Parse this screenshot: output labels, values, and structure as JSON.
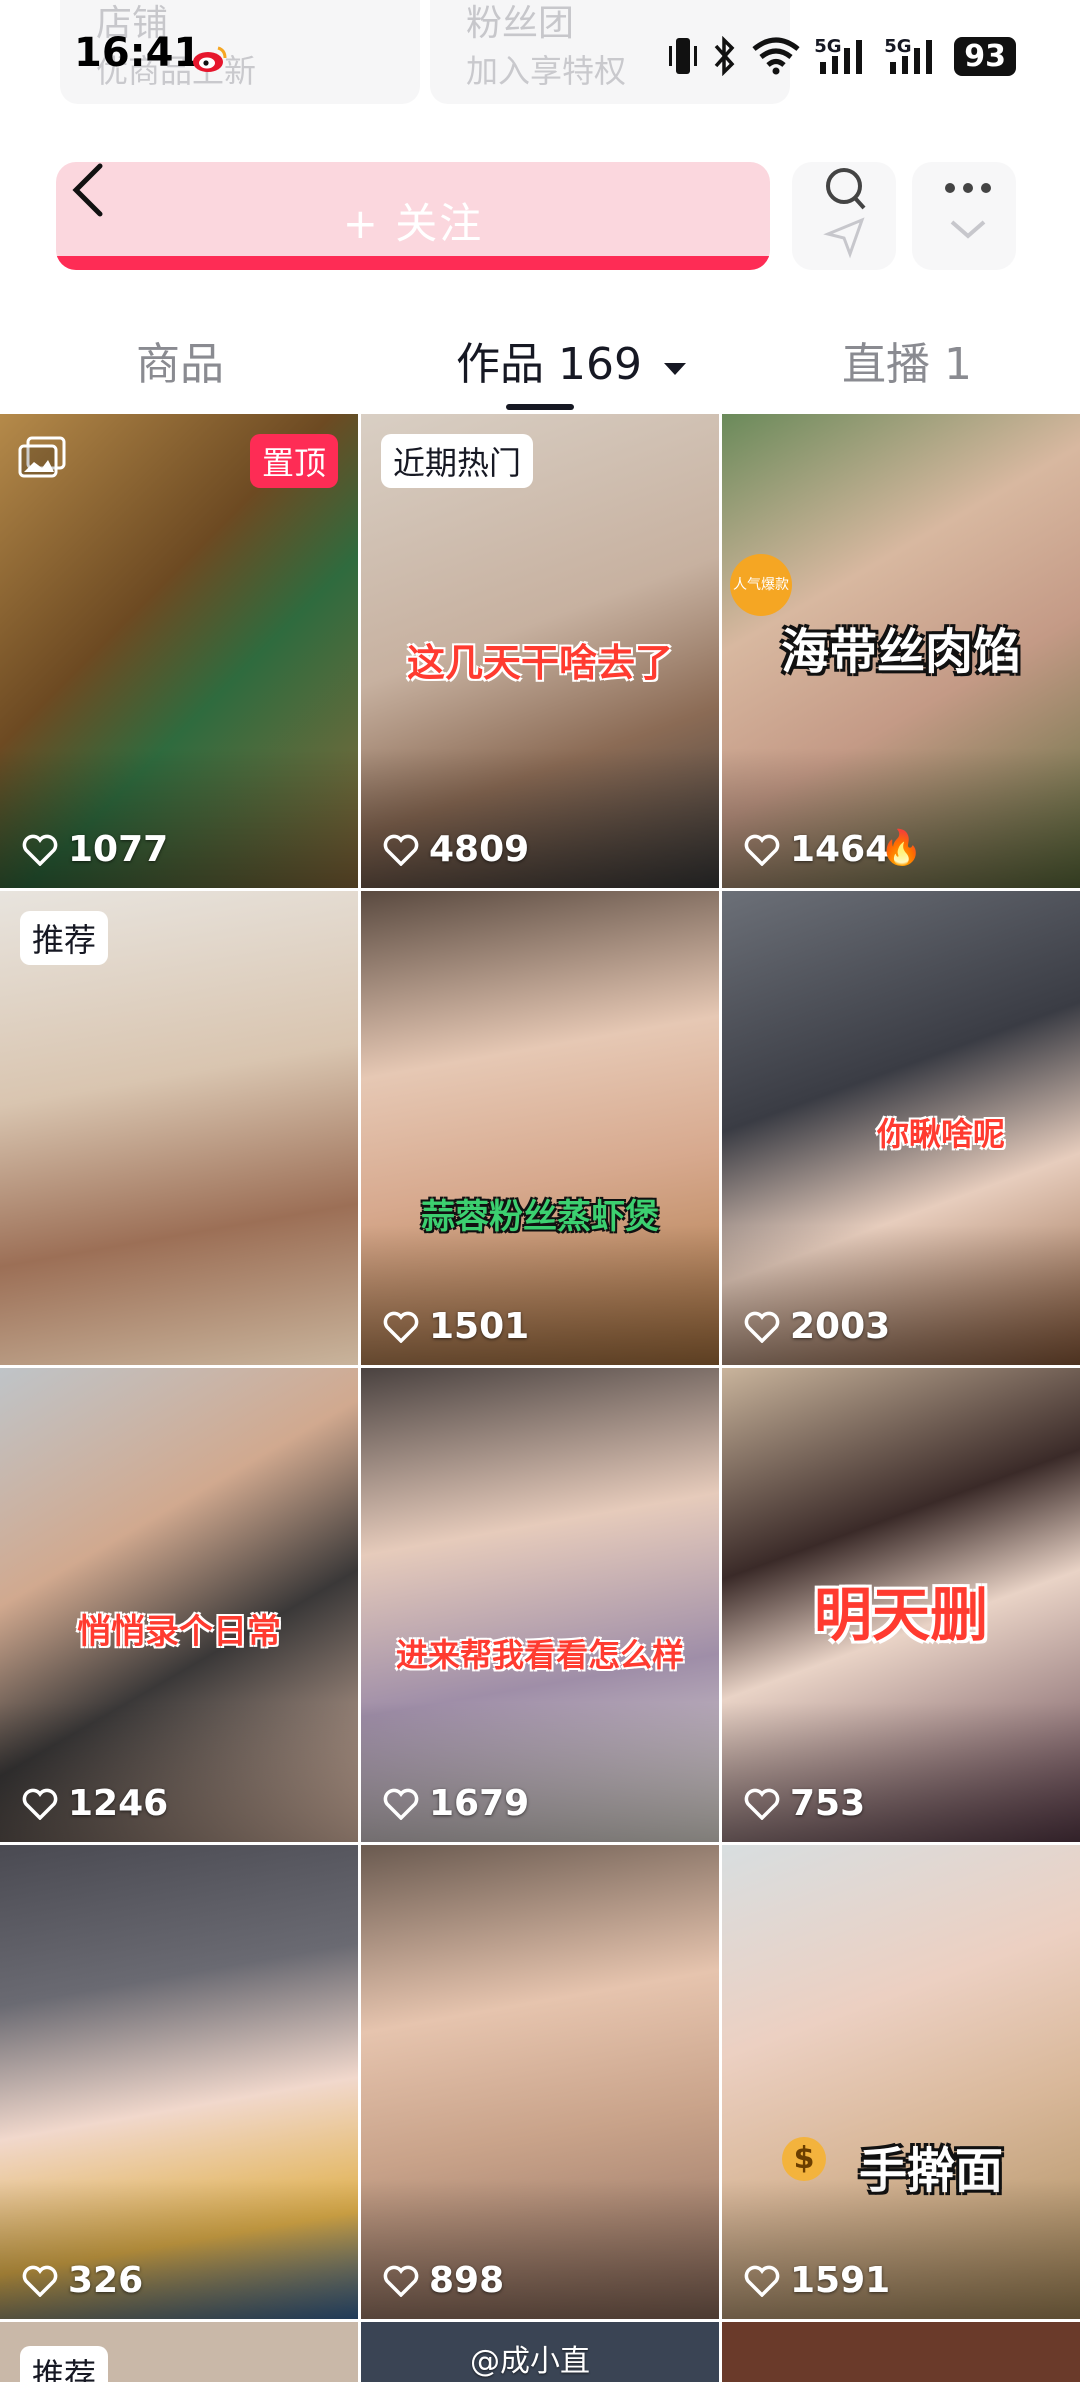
{
  "ghost": {
    "shop_title": "店铺",
    "shop_sub": "优商品上新",
    "fans_title": "粉丝团",
    "fans_sub": "加入享特权"
  },
  "status": {
    "time": "16:41",
    "net1": "5G",
    "net2": "5G",
    "battery": "93"
  },
  "follow": {
    "label": "+ 关注"
  },
  "tabs": {
    "products": "商品",
    "works": "作品 169",
    "live": "直播 1"
  },
  "tiles": [
    {
      "likes": "1077",
      "badge": "置顶"
    },
    {
      "likes": "4809",
      "badge": "近期热门",
      "caption": "这几天干啥去了"
    },
    {
      "likes": "1464",
      "caption": "海带丝肉馅",
      "seal": "人气爆款"
    },
    {
      "likes": "",
      "badge": "推荐"
    },
    {
      "likes": "1501",
      "caption": "蒜蓉粉丝蒸虾煲"
    },
    {
      "likes": "2003",
      "caption": "你瞅啥呢"
    },
    {
      "likes": "1246",
      "caption": "悄悄录个日常"
    },
    {
      "likes": "1679",
      "caption": "进来帮我看看怎么样"
    },
    {
      "likes": "753",
      "caption": "明天删"
    },
    {
      "likes": "326"
    },
    {
      "likes": "898"
    },
    {
      "likes": "1591",
      "caption": "手擀面"
    }
  ],
  "peek_badge": "推荐",
  "watermark": "@成小直",
  "colors": {
    "accent": "#fe2c55",
    "follow_bg": "#fbd7de"
  }
}
